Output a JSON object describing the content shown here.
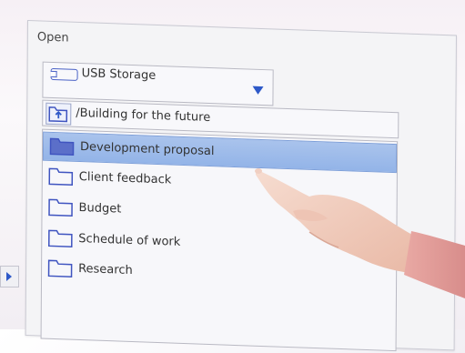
{
  "dialog": {
    "title": "Open"
  },
  "location": {
    "label": "USB Storage",
    "icon": "usb-drive-icon"
  },
  "path": {
    "value": "/Building for the future",
    "icon": "folder-up-icon"
  },
  "folders": [
    {
      "label": "Development proposal",
      "selected": true
    },
    {
      "label": "Client feedback",
      "selected": false
    },
    {
      "label": "Budget",
      "selected": false
    },
    {
      "label": "Schedule of work",
      "selected": false
    },
    {
      "label": "Research",
      "selected": false
    }
  ],
  "colors": {
    "accent": "#2e59c8",
    "selection": "#9bb9ea",
    "folder_stroke": "#3f54c0"
  }
}
